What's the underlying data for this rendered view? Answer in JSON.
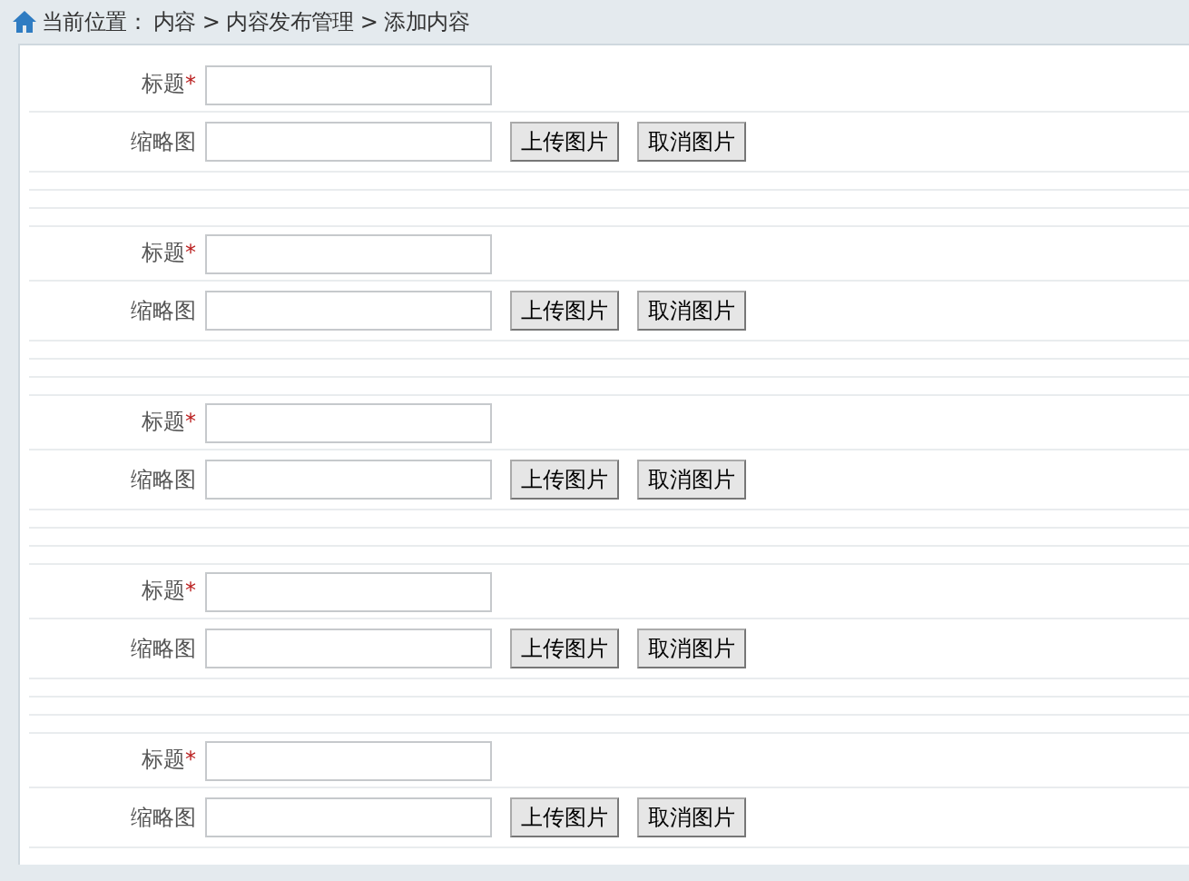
{
  "breadcrumb": {
    "label": "当前位置：",
    "path": "内容 > 内容发布管理 > 添加内容"
  },
  "groups": [
    {
      "fields": [
        {
          "kind": "text",
          "label": "标题",
          "required_mark": "*"
        },
        {
          "kind": "image",
          "label": "缩略图",
          "buttons": [
            "上传图片",
            "取消图片"
          ]
        }
      ]
    },
    {
      "fields": [
        {
          "kind": "text",
          "label": "标题",
          "required_mark": "*"
        },
        {
          "kind": "image",
          "label": "缩略图",
          "buttons": [
            "上传图片",
            "取消图片"
          ]
        }
      ]
    },
    {
      "fields": [
        {
          "kind": "text",
          "label": "标题",
          "required_mark": "*"
        },
        {
          "kind": "image",
          "label": "缩略图",
          "buttons": [
            "上传图片",
            "取消图片"
          ]
        }
      ]
    },
    {
      "fields": [
        {
          "kind": "text",
          "label": "标题",
          "required_mark": "*"
        },
        {
          "kind": "image",
          "label": "缩略图",
          "buttons": [
            "上传图片",
            "取消图片"
          ]
        }
      ]
    },
    {
      "fields": [
        {
          "kind": "text",
          "label": "标题",
          "required_mark": "*"
        },
        {
          "kind": "image",
          "label": "缩略图",
          "buttons": [
            "上传图片",
            "取消图片"
          ]
        }
      ]
    }
  ]
}
